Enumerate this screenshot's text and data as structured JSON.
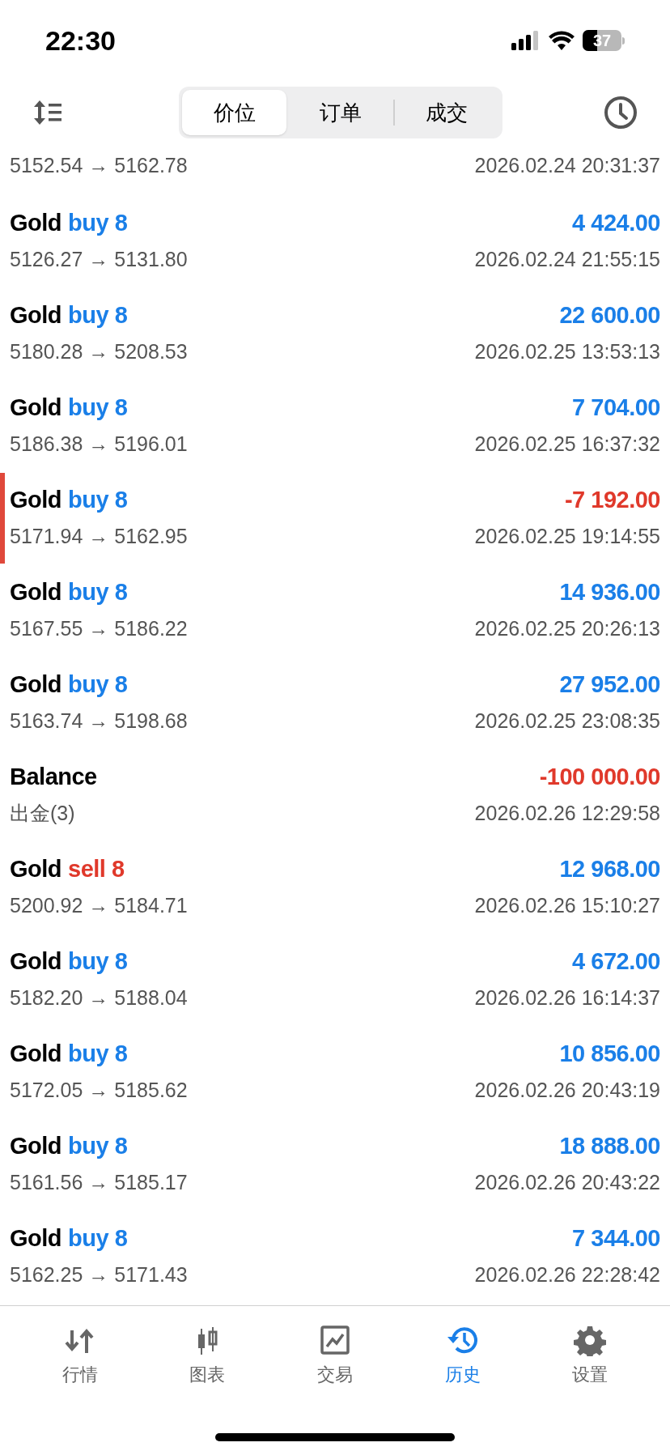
{
  "status_bar": {
    "time": "22:30",
    "battery": "37"
  },
  "segments": [
    {
      "label": "价位",
      "selected": true
    },
    {
      "label": "订单",
      "selected": false
    },
    {
      "label": "成交",
      "selected": false
    }
  ],
  "partial_row": {
    "detail": "5152.54 → 5162.78",
    "time": "2026.02.24 20:31:37"
  },
  "rows": [
    {
      "kind": "buy",
      "symbol": "Gold",
      "volume": "buy 8",
      "profit": "4 424.00",
      "negative": false,
      "flagged": false,
      "detail": "5126.27 → 5131.80",
      "time": "2026.02.24 21:55:15"
    },
    {
      "kind": "buy",
      "symbol": "Gold",
      "volume": "buy 8",
      "profit": "22 600.00",
      "negative": false,
      "flagged": false,
      "detail": "5180.28 → 5208.53",
      "time": "2026.02.25 13:53:13"
    },
    {
      "kind": "buy",
      "symbol": "Gold",
      "volume": "buy 8",
      "profit": "7 704.00",
      "negative": false,
      "flagged": false,
      "detail": "5186.38 → 5196.01",
      "time": "2026.02.25 16:37:32"
    },
    {
      "kind": "buy",
      "symbol": "Gold",
      "volume": "buy 8",
      "profit": "-7 192.00",
      "negative": true,
      "flagged": true,
      "detail": "5171.94 → 5162.95",
      "time": "2026.02.25 19:14:55"
    },
    {
      "kind": "buy",
      "symbol": "Gold",
      "volume": "buy 8",
      "profit": "14 936.00",
      "negative": false,
      "flagged": false,
      "detail": "5167.55 → 5186.22",
      "time": "2026.02.25 20:26:13"
    },
    {
      "kind": "buy",
      "symbol": "Gold",
      "volume": "buy 8",
      "profit": "27 952.00",
      "negative": false,
      "flagged": false,
      "detail": "5163.74 → 5198.68",
      "time": "2026.02.25 23:08:35"
    },
    {
      "kind": "balance",
      "symbol": "Balance",
      "profit": "-100 000.00",
      "negative": true,
      "flagged": false,
      "detail": "出金(3)",
      "time": "2026.02.26 12:29:58"
    },
    {
      "kind": "sell",
      "symbol": "Gold",
      "volume": "sell 8",
      "profit": "12 968.00",
      "negative": false,
      "flagged": false,
      "detail": "5200.92 → 5184.71",
      "time": "2026.02.26 15:10:27"
    },
    {
      "kind": "buy",
      "symbol": "Gold",
      "volume": "buy 8",
      "profit": "4 672.00",
      "negative": false,
      "flagged": false,
      "detail": "5182.20 → 5188.04",
      "time": "2026.02.26 16:14:37"
    },
    {
      "kind": "buy",
      "symbol": "Gold",
      "volume": "buy 8",
      "profit": "10 856.00",
      "negative": false,
      "flagged": false,
      "detail": "5172.05 → 5185.62",
      "time": "2026.02.26 20:43:19"
    },
    {
      "kind": "buy",
      "symbol": "Gold",
      "volume": "buy 8",
      "profit": "18 888.00",
      "negative": false,
      "flagged": false,
      "detail": "5161.56 → 5185.17",
      "time": "2026.02.26 20:43:22"
    },
    {
      "kind": "buy",
      "symbol": "Gold",
      "volume": "buy 8",
      "profit": "7 344.00",
      "negative": false,
      "flagged": false,
      "detail": "5162.25 → 5171.43",
      "time": "2026.02.26 22:28:42"
    }
  ],
  "tab_bar": [
    {
      "kind": "quotes",
      "label": "行情",
      "selected": false
    },
    {
      "kind": "chart",
      "label": "图表",
      "selected": false
    },
    {
      "kind": "trade",
      "label": "交易",
      "selected": false
    },
    {
      "kind": "history",
      "label": "历史",
      "selected": true
    },
    {
      "kind": "settings",
      "label": "设置",
      "selected": false
    }
  ]
}
